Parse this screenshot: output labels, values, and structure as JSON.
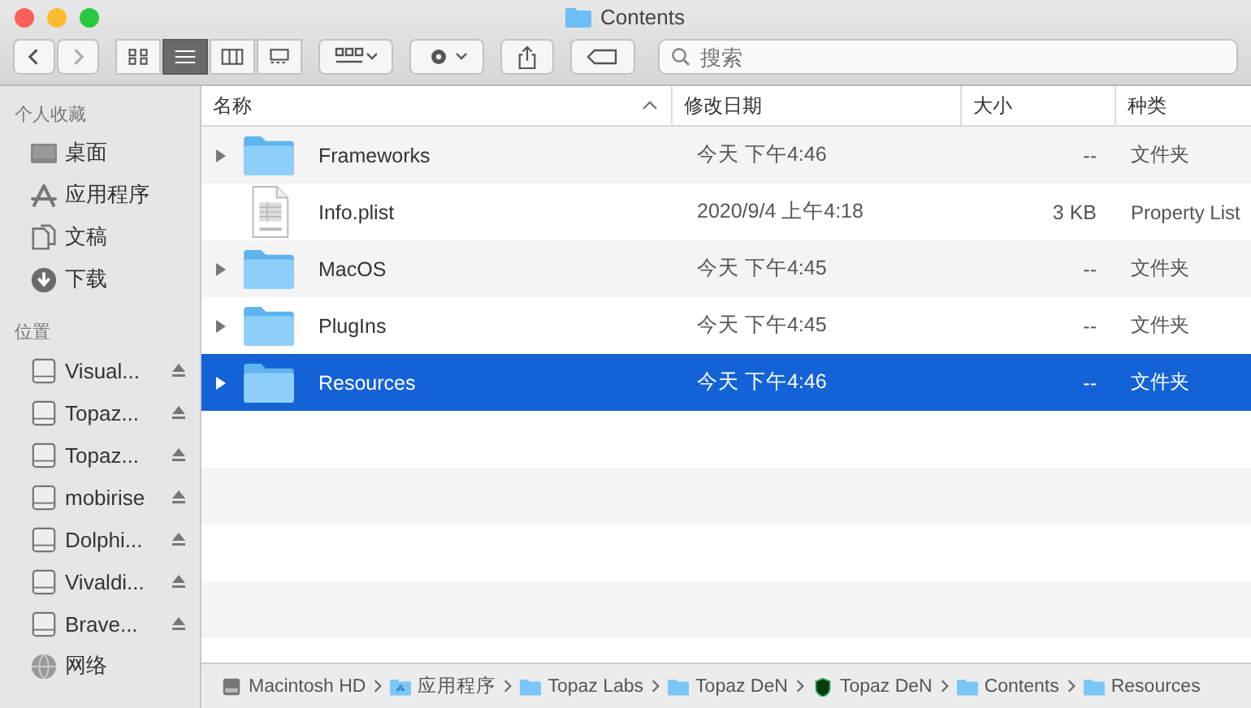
{
  "window": {
    "title": "Contents"
  },
  "toolbar": {
    "view_modes": [
      {
        "kind": "icons",
        "selected": false
      },
      {
        "kind": "list",
        "selected": true
      },
      {
        "kind": "columns",
        "selected": false
      },
      {
        "kind": "gallery",
        "selected": false
      }
    ],
    "search": {
      "placeholder": "搜索"
    }
  },
  "sidebar": {
    "sections": [
      {
        "heading": "个人收藏",
        "items": [
          {
            "label": "桌面",
            "kind": "desktop",
            "eject": false
          },
          {
            "label": "应用程序",
            "kind": "apps",
            "eject": false
          },
          {
            "label": "文稿",
            "kind": "docs",
            "eject": false
          },
          {
            "label": "下载",
            "kind": "download",
            "eject": false
          }
        ]
      },
      {
        "heading": "位置",
        "items": [
          {
            "label": "Visual...",
            "kind": "drive",
            "eject": true
          },
          {
            "label": "Topaz...",
            "kind": "drive",
            "eject": true
          },
          {
            "label": "Topaz...",
            "kind": "drive",
            "eject": true
          },
          {
            "label": "mobirise",
            "kind": "drive",
            "eject": true
          },
          {
            "label": "Dolphi...",
            "kind": "drive",
            "eject": true
          },
          {
            "label": "Vivaldi...",
            "kind": "drive",
            "eject": true
          },
          {
            "label": "Brave...",
            "kind": "drive",
            "eject": true
          },
          {
            "label": "网络",
            "kind": "network",
            "eject": false
          }
        ]
      }
    ]
  },
  "table": {
    "columns": [
      {
        "label": "名称",
        "sorted": true
      },
      {
        "label": "修改日期",
        "sorted": false
      },
      {
        "label": "大小",
        "sorted": false
      },
      {
        "label": "种类",
        "sorted": false
      }
    ],
    "rows": [
      {
        "kind": "folder",
        "name": "Frameworks",
        "date": "今天 下午4:46",
        "size": "--",
        "type": "文件夹",
        "selected": false
      },
      {
        "kind": "file",
        "name": "Info.plist",
        "date": "2020/9/4 上午4:18",
        "size": "3 KB",
        "type": "Property List",
        "selected": false
      },
      {
        "kind": "folder",
        "name": "MacOS",
        "date": "今天 下午4:45",
        "size": "--",
        "type": "文件夹",
        "selected": false
      },
      {
        "kind": "folder",
        "name": "PlugIns",
        "date": "今天 下午4:45",
        "size": "--",
        "type": "文件夹",
        "selected": false
      },
      {
        "kind": "folder",
        "name": "Resources",
        "date": "今天 下午4:46",
        "size": "--",
        "type": "文件夹",
        "selected": true
      }
    ]
  },
  "path_bar": [
    {
      "label": "Macintosh HD",
      "kind": "disk"
    },
    {
      "label": "应用程序",
      "kind": "apps-folder"
    },
    {
      "label": "Topaz Labs",
      "kind": "folder"
    },
    {
      "label": "Topaz DeN",
      "kind": "folder"
    },
    {
      "label": "Topaz DeN",
      "kind": "app"
    },
    {
      "label": "Contents",
      "kind": "folder"
    },
    {
      "label": "Resources",
      "kind": "folder"
    }
  ]
}
